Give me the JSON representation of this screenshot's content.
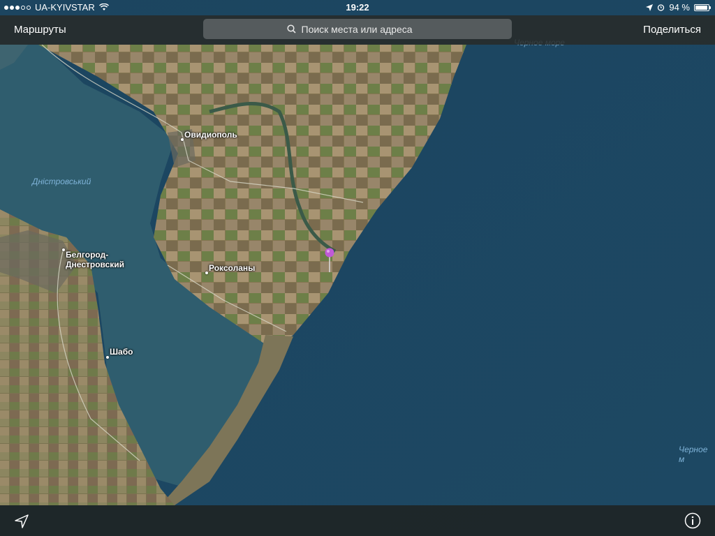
{
  "status_bar": {
    "carrier": "UA-KYIVSTAR",
    "time": "19:22",
    "battery": "94 %",
    "battery_level": 0.94,
    "signal_bars_filled": 3,
    "signal_bars_total": 5
  },
  "nav": {
    "routes_label": "Маршруты",
    "search_placeholder": "Поиск места или адреса",
    "share_label": "Поделиться"
  },
  "map": {
    "places": [
      {
        "name": "Овидиополь"
      },
      {
        "name": "Белгород-\nДнестровский"
      },
      {
        "name": "Роксоланы"
      },
      {
        "name": "Шабо"
      }
    ],
    "water_labels": [
      {
        "name": "Дністровський"
      },
      {
        "name": "Черное м"
      },
      {
        "name": "Черное море"
      }
    ],
    "pin_color": "#c05ad8"
  },
  "icons": {
    "location": "location-arrow-icon",
    "info": "info-icon"
  }
}
